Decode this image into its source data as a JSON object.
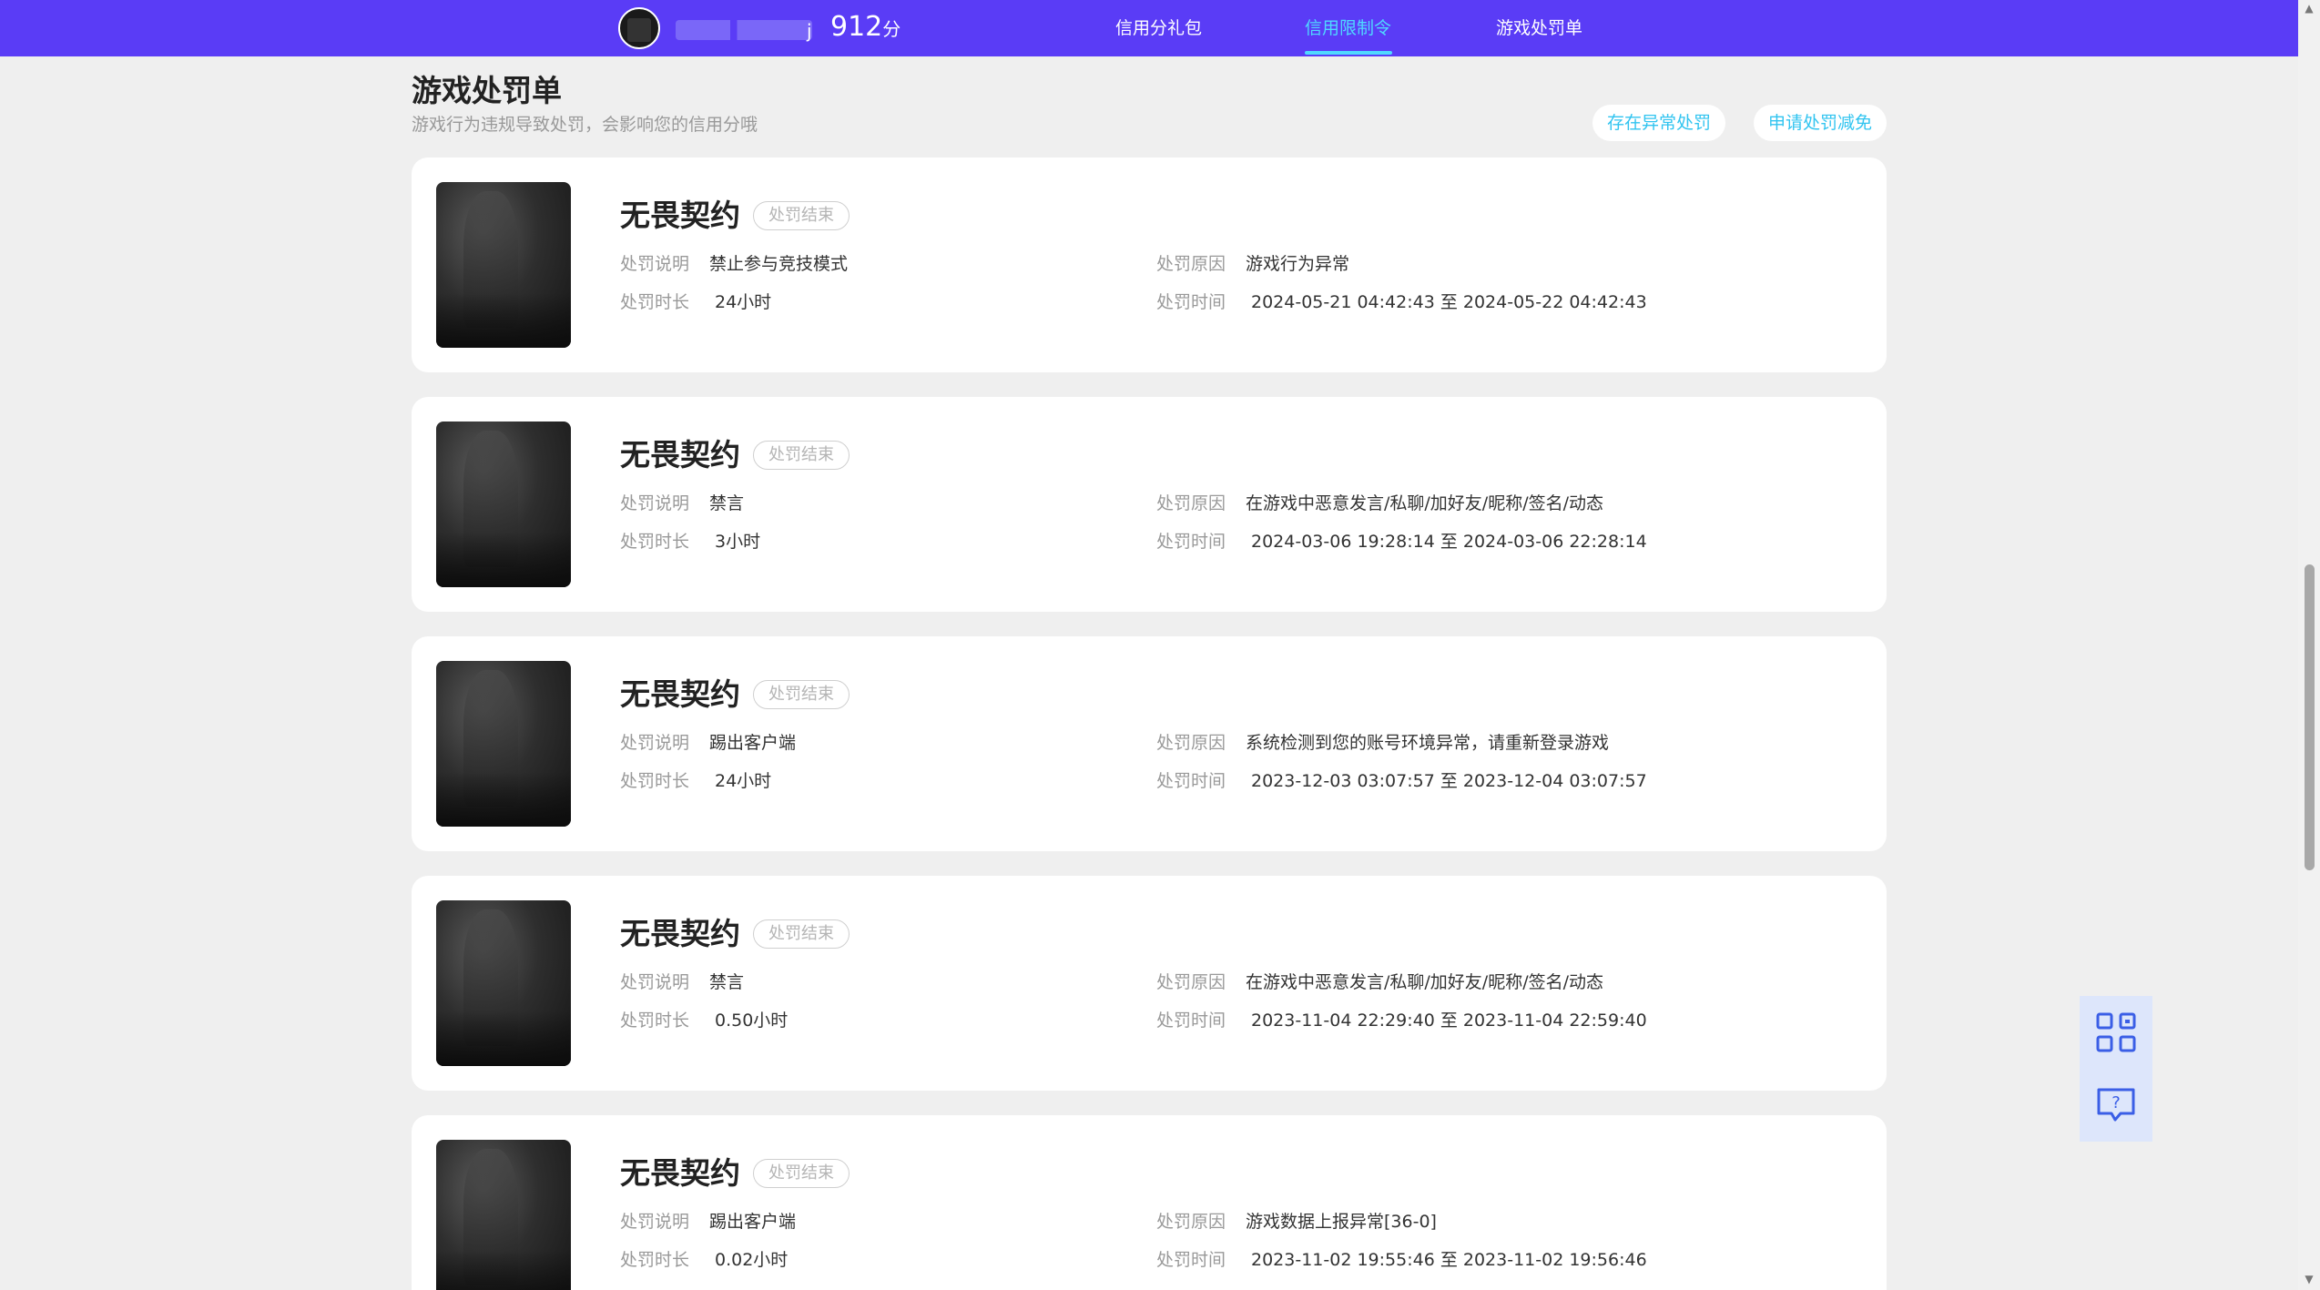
{
  "header": {
    "username_suffix": "j",
    "score_value": "912",
    "score_unit": "分",
    "nav": [
      {
        "label": "信用分礼包",
        "active": false
      },
      {
        "label": "信用限制令",
        "active": true
      },
      {
        "label": "游戏处罚单",
        "active": false
      }
    ]
  },
  "page": {
    "title": "游戏处罚单",
    "subtitle": "游戏行为违规导致处罚，会影响您的信用分哦",
    "btn_abnormal": "存在异常处罚",
    "btn_appeal": "申请处罚减免"
  },
  "labels": {
    "desc": "处罚说明",
    "duration": "处罚时长",
    "reason": "处罚原因",
    "time": "处罚时间"
  },
  "records": [
    {
      "game": "无畏契约",
      "status": "处罚结束",
      "desc": "禁止参与竞技模式",
      "duration": "24小时",
      "reason": "游戏行为异常",
      "time": "2024-05-21 04:42:43 至 2024-05-22 04:42:43"
    },
    {
      "game": "无畏契约",
      "status": "处罚结束",
      "desc": "禁言",
      "duration": "3小时",
      "reason": "在游戏中恶意发言/私聊/加好友/昵称/签名/动态",
      "time": "2024-03-06 19:28:14 至 2024-03-06 22:28:14"
    },
    {
      "game": "无畏契约",
      "status": "处罚结束",
      "desc": "踢出客户端",
      "duration": "24小时",
      "reason": "系统检测到您的账号环境异常，请重新登录游戏",
      "time": "2023-12-03 03:07:57 至 2023-12-04 03:07:57"
    },
    {
      "game": "无畏契约",
      "status": "处罚结束",
      "desc": "禁言",
      "duration": "0.50小时",
      "reason": "在游戏中恶意发言/私聊/加好友/昵称/签名/动态",
      "time": "2023-11-04 22:29:40 至 2023-11-04 22:59:40"
    },
    {
      "game": "无畏契约",
      "status": "处罚结束",
      "desc": "踢出客户端",
      "duration": "0.02小时",
      "reason": "游戏数据上报异常[36-0]",
      "time": "2023-11-02 19:55:46 至 2023-11-02 19:56:46"
    }
  ],
  "float_tools": {
    "qr_icon": "qrcode-icon",
    "help_icon": "question-chat-icon"
  },
  "colors": {
    "header_bg": "#5a3cf6",
    "active_nav": "#4fd9ff",
    "pill_text": "#31c4f0",
    "float_bg": "#dde6fb"
  }
}
